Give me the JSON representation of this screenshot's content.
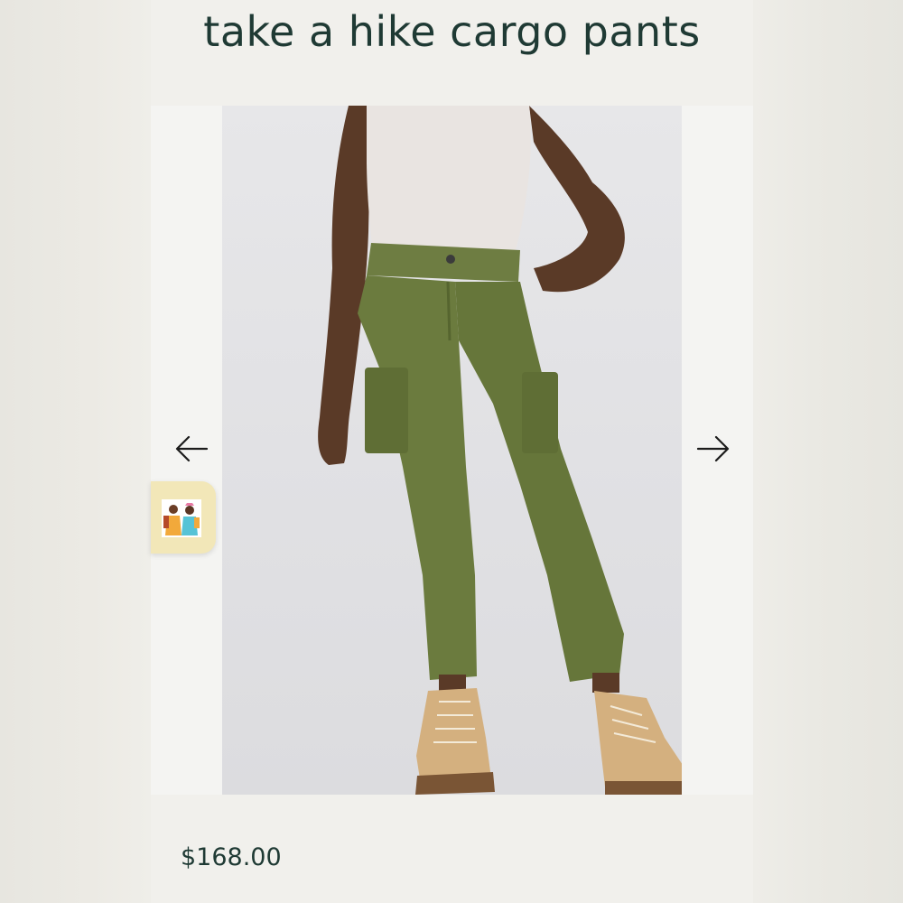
{
  "product": {
    "title": "take a hike cargo pants",
    "price": "$168.00"
  },
  "gallery": {
    "prev_icon": "arrow-left-icon",
    "next_icon": "arrow-right-icon",
    "image_subject": "model-wearing-olive-cargo-pants"
  },
  "chat_widget": {
    "icon": "hikers-avatar-icon"
  },
  "colors": {
    "heading": "#1f3a34",
    "pants": "#6b7b3e",
    "widget_bg": "#f2e7b8"
  }
}
